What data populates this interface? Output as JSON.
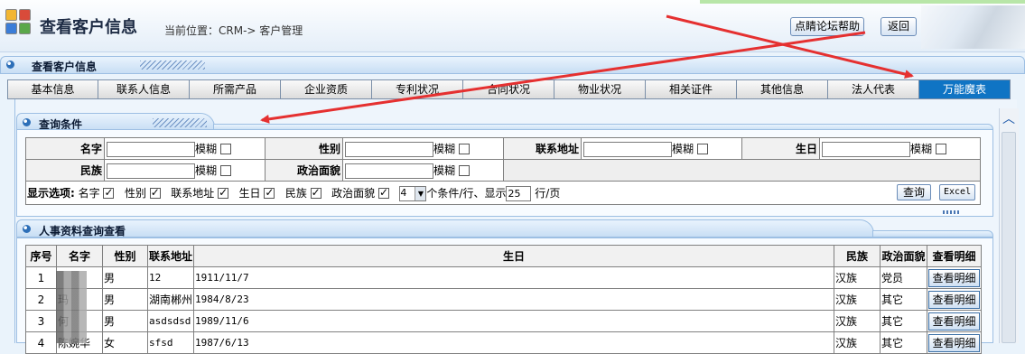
{
  "header": {
    "app_title": "查看客户信息",
    "breadcrumb": "当前位置：CRM-> 客户管理",
    "help_button": "点睛论坛帮助",
    "back_button": "返回"
  },
  "section_title": "查看客户信息",
  "tabs": [
    {
      "label": "基本信息"
    },
    {
      "label": "联系人信息"
    },
    {
      "label": "所需产品"
    },
    {
      "label": "企业资质"
    },
    {
      "label": "专利状况"
    },
    {
      "label": "合同状况"
    },
    {
      "label": "物业状况"
    },
    {
      "label": "相关证件"
    },
    {
      "label": "其他信息"
    },
    {
      "label": "法人代表"
    },
    {
      "label": "万能魔表",
      "active": true
    }
  ],
  "query": {
    "title": "查询条件",
    "fuzzy_label": "模糊",
    "fields": {
      "name": "名字",
      "gender": "性别",
      "address": "联系地址",
      "birthday": "生日",
      "ethnicity": "民族",
      "politics": "政治面貌"
    },
    "options_label": "显示选项:",
    "options": [
      "名字",
      "性别",
      "联系地址",
      "生日",
      "民族",
      "政治面貌"
    ],
    "per_row_value": "4",
    "per_row_text": "个条件/行、显示",
    "page_size": "25",
    "page_suffix": "行/页",
    "search_button": "查询",
    "excel_button": "Excel"
  },
  "results": {
    "title": "人事资料查询查看",
    "columns": [
      "序号",
      "名字",
      "性别",
      "联系地址",
      "生日",
      "民族",
      "政治面貌",
      "查看明细"
    ],
    "detail_label": "查看明细",
    "rows": [
      {
        "no": "1",
        "name": "",
        "gender": "男",
        "address": "12",
        "birthday": "1911/11/7",
        "ethnicity": "汉族",
        "politics": "党员"
      },
      {
        "no": "2",
        "name": "玛",
        "gender": "男",
        "address": "湖南郴州",
        "birthday": "1984/8/23",
        "ethnicity": "汉族",
        "politics": "其它"
      },
      {
        "no": "3",
        "name": "何",
        "gender": "男",
        "address": "asdsdsd",
        "birthday": "1989/11/6",
        "ethnicity": "汉族",
        "politics": "其它"
      },
      {
        "no": "4",
        "name": "陈婉华",
        "gender": "女",
        "address": "sfsd",
        "birthday": "1987/6/13",
        "ethnicity": "汉族",
        "politics": "其它"
      }
    ]
  },
  "colors": {
    "active_tab": "#0f74c4",
    "annotation_arrow": "#e53030"
  }
}
